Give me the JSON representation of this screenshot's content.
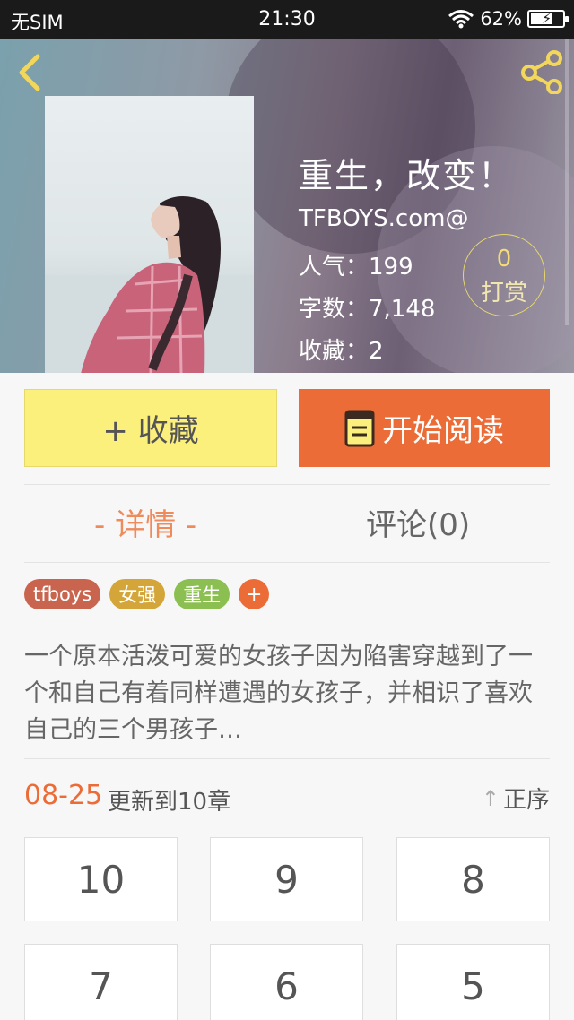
{
  "status_bar": {
    "carrier": "无SIM",
    "time": "21:30",
    "battery": "62%",
    "battery_level": 0.62
  },
  "header": {
    "back_icon": "chevron-left-icon",
    "share_icon": "share-icon",
    "title": "重生，改变！",
    "author": "TFBOYS.com@",
    "popularity": "人气：199",
    "word_count": "字数：7,148",
    "favorites": "收藏：2",
    "reward_count": "0",
    "reward_label": "打赏",
    "accent_color": "#f2d75a"
  },
  "actions": {
    "favorite_label": "+ 收藏",
    "read_label": "开始阅读",
    "read_icon": "book-icon"
  },
  "tabs": [
    {
      "label": "- 详情 -",
      "active": true
    },
    {
      "label": "评论(0)",
      "active": false
    }
  ],
  "tags": [
    {
      "label": "tfboys",
      "color": "#c9654e"
    },
    {
      "label": "女强",
      "color": "#d4a63a"
    },
    {
      "label": "重生",
      "color": "#8cbf52"
    }
  ],
  "tag_add_label": "+",
  "intro": "一个原本活泼可爱的女孩子因为陷害穿越到了一个和自己有着同样遭遇的女孩子，并相识了喜欢自己的三个男孩子…",
  "update": {
    "date": "08-25",
    "text": "更新到10章",
    "order_label": "正序"
  },
  "chapters": [
    "10",
    "9",
    "8",
    "7",
    "6",
    "5"
  ],
  "colors": {
    "accent": "#ec6c37",
    "favorite_bg": "#fcf07c"
  }
}
